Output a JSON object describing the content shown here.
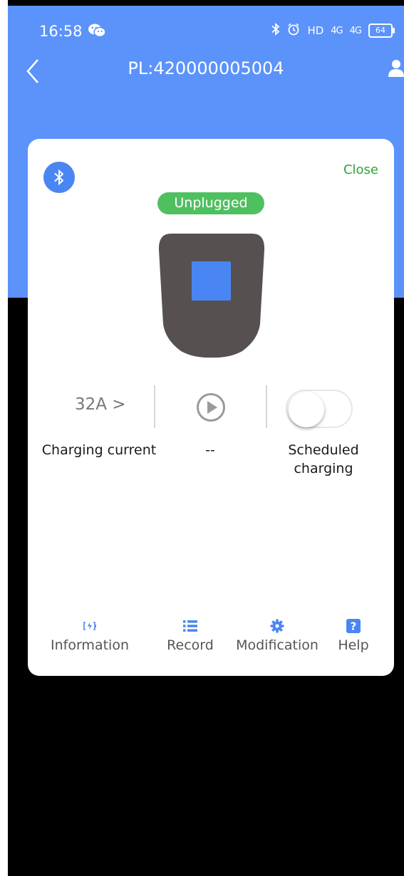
{
  "status_bar": {
    "time": "16:58",
    "hd": "HD",
    "signal1": "4G",
    "signal2": "4G",
    "battery": "64"
  },
  "header": {
    "title": "PL:420000005004"
  },
  "card": {
    "close_label": "Close",
    "status_label": "Unplugged",
    "current_value": "32A >",
    "current_label": "Charging current",
    "play_label": "--",
    "scheduled_label_line1": "Scheduled",
    "scheduled_label_line2": "charging",
    "scheduled_enabled": false
  },
  "bottom_nav": {
    "items": [
      {
        "label": "Information",
        "icon": "battery-charge-icon"
      },
      {
        "label": "Record",
        "icon": "list-icon"
      },
      {
        "label": "Modification",
        "icon": "gear-icon"
      },
      {
        "label": "Help",
        "icon": "help-icon"
      }
    ]
  },
  "colors": {
    "header_blue": "#5b93fb",
    "accent_blue": "#4a86f3",
    "status_green": "#4fc060",
    "close_green": "#2fa43d",
    "charger_body": "#575050"
  }
}
